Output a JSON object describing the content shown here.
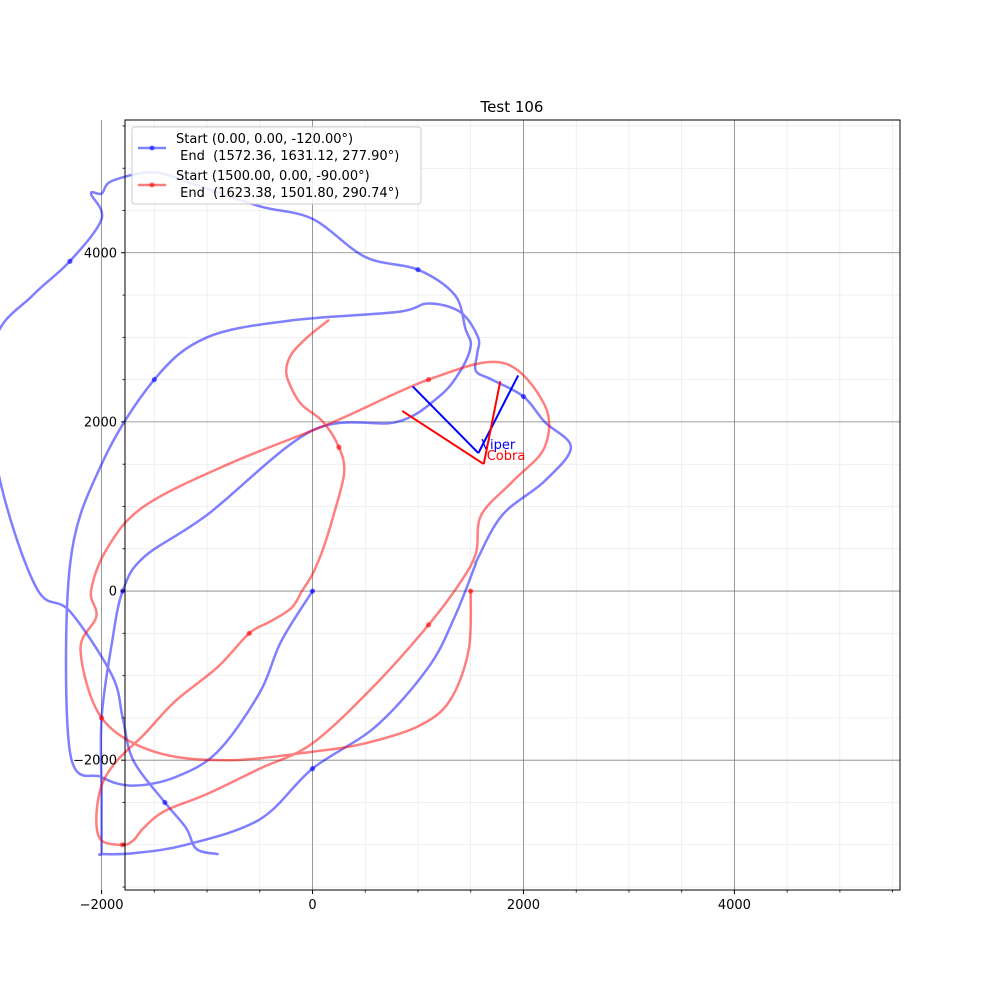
{
  "chart_data": {
    "type": "line",
    "title": "Test 106",
    "xlim": [
      -1778,
      5570
    ],
    "ylim": [
      -3535,
      5570
    ],
    "x_ticks": [
      -2000,
      0,
      2000,
      4000
    ],
    "y_ticks": [
      -2000,
      0,
      2000,
      4000
    ],
    "x_tick_labels": [
      "−2000",
      "0",
      "2000",
      "4000"
    ],
    "y_tick_labels": [
      "−2000",
      "0",
      "2000",
      "4000"
    ],
    "grid": true,
    "legend_position": "upper-left",
    "series": [
      {
        "name": "Start (0.00, 0.00, -120.00°)\n End  (1572.36, 1631.12, 277.90°)",
        "legend_line1": "Start (0.00, 0.00, -120.00°)",
        "legend_line2": " End  (1572.36, 1631.12, 277.90°)",
        "color": "#0000ff",
        "x": [
          0,
          -300,
          -500,
          -900,
          -1300,
          -1700,
          -2000,
          -2300,
          -2300,
          -2000,
          -1500,
          -1000,
          -200,
          800,
          1100,
          1400,
          1570,
          1560,
          1550,
          1700,
          2000,
          2200,
          2450,
          2200,
          1800,
          1560,
          1540,
          1350,
          1100,
          600,
          0,
          -500,
          -1200,
          -1700,
          -2000,
          -2000,
          -2000,
          -2000,
          -2000,
          -1900,
          -1800,
          -1600,
          -1000,
          0,
          800,
          1200,
          1400,
          1500,
          1450,
          1350,
          1000,
          500,
          0,
          -500,
          -1100,
          -1500,
          -1900,
          -2000,
          -2100,
          -2000,
          -2300,
          -2650,
          -3000,
          -3050,
          -2900,
          -2600,
          -2300,
          -1900,
          -1800,
          -1700,
          -1400,
          -1200,
          -1100,
          -900
        ],
        "y": [
          0,
          -600,
          -1200,
          -1900,
          -2200,
          -2300,
          -2200,
          -1900,
          300,
          1500,
          2500,
          3000,
          3200,
          3300,
          3400,
          3300,
          3000,
          2800,
          2600,
          2500,
          2300,
          2000,
          1700,
          1300,
          900,
          370,
          300,
          -300,
          -900,
          -1600,
          -2100,
          -2700,
          -3000,
          -3100,
          -3110,
          -3100,
          -2900,
          -2400,
          -1500,
          -600,
          0,
          400,
          900,
          1900,
          2000,
          2300,
          2600,
          2900,
          3100,
          3500,
          3800,
          3950,
          4400,
          4550,
          4800,
          4950,
          4850,
          4700,
          4700,
          4400,
          3900,
          3500,
          3000,
          2000,
          1000,
          0,
          -240,
          -1000,
          -1500,
          -2000,
          -2500,
          -2800,
          -3050,
          -3110
        ],
        "start_label": null,
        "end_label": "Viper",
        "end_point": [
          1572.36,
          1631.12
        ],
        "heading_lines": [
          {
            "from": [
              1572.36,
              1631.12
            ],
            "to": [
              950,
              2420
            ]
          },
          {
            "from": [
              1572.36,
              1631.12
            ],
            "to": [
              1950,
              2550
            ]
          }
        ]
      },
      {
        "name": "Start (1500.00, 0.00, -90.00°)\n End  (1623.38, 1501.80, 290.74°)",
        "legend_line1": "Start (1500.00, 0.00, -90.00°)",
        "legend_line2": " End  (1623.38, 1501.80, 290.74°)",
        "color": "#ff0000",
        "x": [
          1500,
          1480,
          1300,
          1000,
          500,
          0,
          -800,
          -1500,
          -2000,
          -2200,
          -2050,
          -2100,
          -1950,
          -1600,
          -800,
          200,
          1100,
          1800,
          2200,
          2200,
          1900,
          1600,
          1550,
          1400,
          1100,
          600,
          0,
          -500,
          -1000,
          -1400,
          -1600,
          -1700,
          -1800,
          -2000,
          -2050,
          -2000,
          -1850,
          -1600,
          -1300,
          -900,
          -600,
          -400,
          -200,
          -100,
          0,
          100,
          200,
          300,
          250,
          100,
          -100,
          -200,
          -250,
          -200,
          -50,
          150
        ],
        "y": [
          0,
          -700,
          -1300,
          -1600,
          -1800,
          -1900,
          -2000,
          -1900,
          -1500,
          -700,
          -300,
          0,
          500,
          1000,
          1500,
          2000,
          2500,
          2700,
          2200,
          1700,
          1300,
          900,
          450,
          100,
          -400,
          -1100,
          -1800,
          -2100,
          -2400,
          -2600,
          -2800,
          -2950,
          -3000,
          -2950,
          -2700,
          -2300,
          -2000,
          -1700,
          -1300,
          -900,
          -500,
          -360,
          -200,
          0,
          200,
          500,
          900,
          1400,
          1700,
          2000,
          2200,
          2400,
          2600,
          2800,
          3000,
          3200
        ],
        "start_label": null,
        "end_label": "Cobra",
        "end_point": [
          1623.38,
          1501.8
        ],
        "heading_lines": [
          {
            "from": [
              1623.38,
              1501.8
            ],
            "to": [
              850,
              2130
            ]
          },
          {
            "from": [
              1623.38,
              1501.8
            ],
            "to": [
              1780,
              2480
            ]
          }
        ]
      }
    ]
  }
}
